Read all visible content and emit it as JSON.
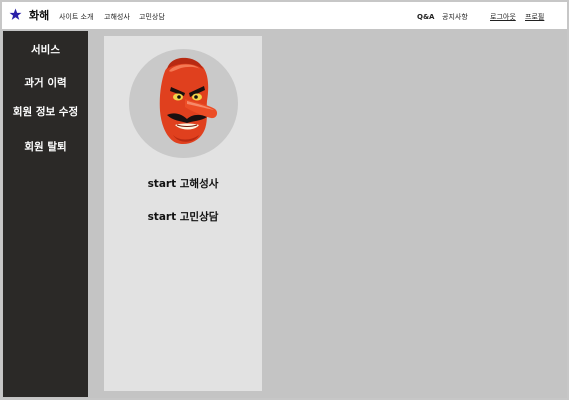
{
  "header": {
    "brand": "화해",
    "logo_icon": "star-icon",
    "accent_color": "#2a1fa8",
    "nav_left": [
      "사이트 소개",
      "고해성사",
      "고민상담"
    ],
    "nav_right": {
      "qna": "Q&A",
      "notice": "공지사항",
      "logout": "로그아웃",
      "profile": "프로필"
    }
  },
  "sidebar": {
    "items": [
      {
        "label": "서비스"
      },
      {
        "label": "과거 이력"
      },
      {
        "label": "회원 정보 수정"
      },
      {
        "label": "회원 탈퇴"
      }
    ]
  },
  "main": {
    "avatar_icon": "tengu-mask-icon",
    "actions": [
      {
        "label": "start 고해성사"
      },
      {
        "label": "start 고민상담"
      }
    ]
  },
  "colors": {
    "sidebar_bg": "#2b2927",
    "panel_bg": "#e2e2e2",
    "page_bg": "#c4c4c4"
  }
}
